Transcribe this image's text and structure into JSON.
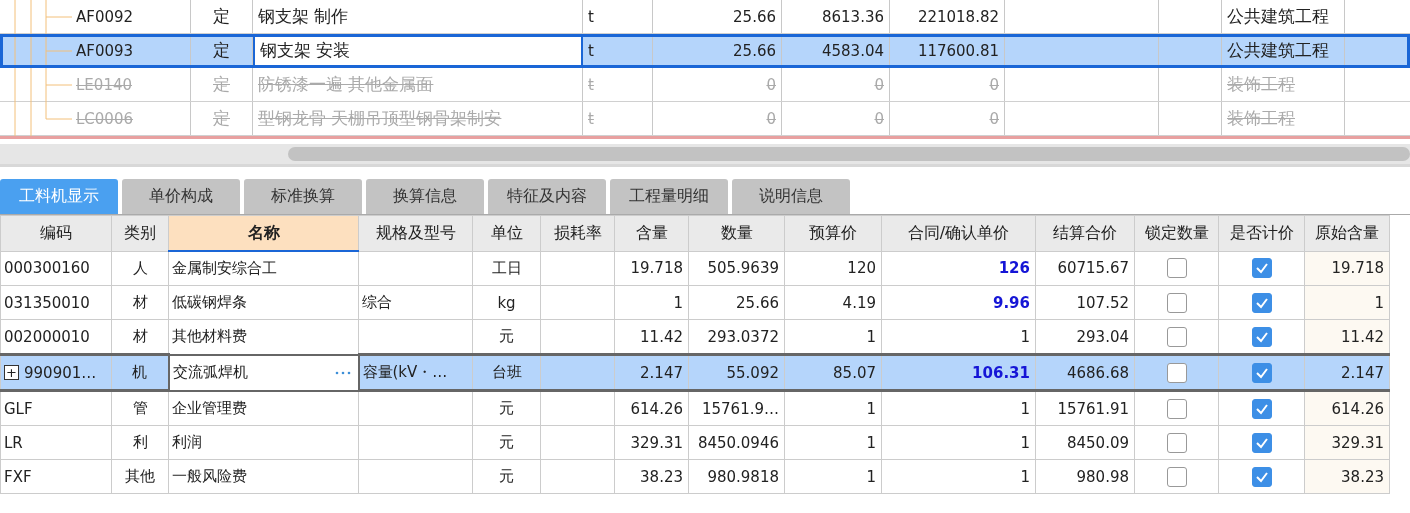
{
  "items": [
    {
      "code": "AF0092",
      "type": "定",
      "name": "钢支架 制作",
      "unit": "t",
      "quantity": "25.66",
      "unit_price": "8613.36",
      "total": "221018.82",
      "specialty": "公共建筑工程",
      "selected": false,
      "struck": false
    },
    {
      "code": "AF0093",
      "type": "定",
      "name": "钢支架 安装",
      "unit": "t",
      "quantity": "25.66",
      "unit_price": "4583.04",
      "total": "117600.81",
      "specialty": "公共建筑工程",
      "selected": true,
      "struck": false
    },
    {
      "code": "LE0140",
      "type": "定",
      "name": "防锈漆一遍 其他金属面",
      "unit": "t",
      "quantity": "0",
      "unit_price": "0",
      "total": "0",
      "specialty": "装饰工程",
      "selected": false,
      "struck": true
    },
    {
      "code": "LC0006",
      "type": "定",
      "name": "型钢龙骨 天棚吊顶型钢骨架制安",
      "unit": "t",
      "quantity": "0",
      "unit_price": "0",
      "total": "0",
      "specialty": "装饰工程",
      "selected": false,
      "struck": true
    }
  ],
  "tabs": [
    {
      "label": "工料机显示",
      "selected": true
    },
    {
      "label": "单价构成",
      "selected": false
    },
    {
      "label": "标准换算",
      "selected": false
    },
    {
      "label": "换算信息",
      "selected": false
    },
    {
      "label": "特征及内容",
      "selected": false
    },
    {
      "label": "工程量明细",
      "selected": false
    },
    {
      "label": "说明信息",
      "selected": false
    }
  ],
  "resources": {
    "columns": [
      {
        "label": "编码",
        "selected": false
      },
      {
        "label": "类别",
        "selected": false
      },
      {
        "label": "名称",
        "selected": true
      },
      {
        "label": "规格及型号",
        "selected": false
      },
      {
        "label": "单位",
        "selected": false
      },
      {
        "label": "损耗率",
        "selected": false
      },
      {
        "label": "含量",
        "selected": false
      },
      {
        "label": "数量",
        "selected": false
      },
      {
        "label": "预算价",
        "selected": false
      },
      {
        "label": "合同/确认单价",
        "selected": false
      },
      {
        "label": "结算合价",
        "selected": false
      },
      {
        "label": "锁定数量",
        "selected": false
      },
      {
        "label": "是否计价",
        "selected": false
      },
      {
        "label": "原始含量",
        "selected": false
      }
    ],
    "rows": [
      {
        "code": "000300160",
        "category": "人",
        "name": "金属制安综合工",
        "unit": "工日",
        "content": "19.718",
        "amount": "505.9639",
        "budget_price": "120",
        "contract_price": "126",
        "price_changed": true,
        "settled_total": "60715.67",
        "locked": false,
        "priced": true,
        "original_content": "19.718",
        "selected": false,
        "expandable": false
      },
      {
        "code": "031350010",
        "category": "材",
        "name": "低碳钢焊条",
        "spec": "综合",
        "unit": "kg",
        "content": "1",
        "amount": "25.66",
        "budget_price": "4.19",
        "contract_price": "9.96",
        "price_changed": true,
        "settled_total": "107.52",
        "locked": false,
        "priced": true,
        "original_content": "1",
        "selected": false,
        "expandable": false
      },
      {
        "code": "002000010",
        "category": "材",
        "name": "其他材料费",
        "unit": "元",
        "content": "11.42",
        "amount": "293.0372",
        "budget_price": "1",
        "contract_price": "1",
        "price_changed": false,
        "settled_total": "293.04",
        "locked": false,
        "priced": true,
        "original_content": "11.42",
        "selected": false,
        "expandable": false
      },
      {
        "code": "990901…",
        "category": "机",
        "name": "交流弧焊机",
        "spec": "容量(kV・…",
        "unit": "台班",
        "content": "2.147",
        "amount": "55.092",
        "budget_price": "85.07",
        "contract_price": "106.31",
        "price_changed": true,
        "settled_total": "4686.68",
        "locked": false,
        "priced": true,
        "original_content": "2.147",
        "selected": true,
        "expandable": true,
        "expand_symbol": "+"
      },
      {
        "code": "GLF",
        "category": "管",
        "name": "企业管理费",
        "unit": "元",
        "content": "614.26",
        "amount": "15761.9…",
        "budget_price": "1",
        "contract_price": "1",
        "price_changed": false,
        "settled_total": "15761.91",
        "locked": false,
        "priced": true,
        "original_content": "614.26",
        "selected": false,
        "expandable": false
      },
      {
        "code": "LR",
        "category": "利",
        "name": "利润",
        "unit": "元",
        "content": "329.31",
        "amount": "8450.0946",
        "budget_price": "1",
        "contract_price": "1",
        "price_changed": false,
        "settled_total": "8450.09",
        "locked": false,
        "priced": true,
        "original_content": "329.31",
        "selected": false,
        "expandable": false
      },
      {
        "code": "FXF",
        "category": "其他",
        "name": "一般风险费",
        "unit": "元",
        "content": "38.23",
        "amount": "980.9818",
        "budget_price": "1",
        "contract_price": "1",
        "price_changed": false,
        "settled_total": "980.98",
        "locked": false,
        "priced": true,
        "original_content": "38.23",
        "selected": false,
        "expandable": false
      }
    ]
  }
}
